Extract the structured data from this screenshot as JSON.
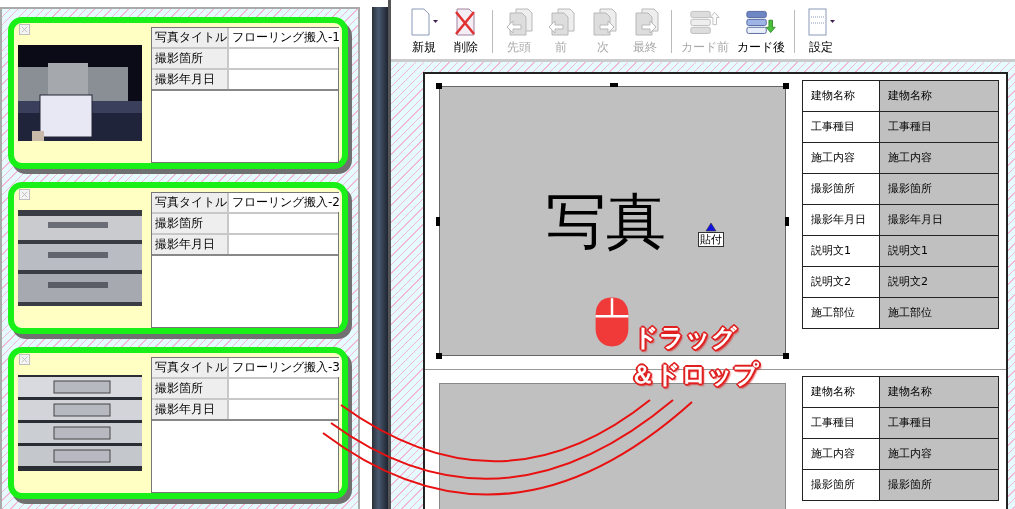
{
  "photo_list": {
    "cards": [
      {
        "kind": "picture",
        "selected": true,
        "title_label": "写真タイトル",
        "title": "フローリング搬入-1",
        "fields": [
          {
            "label": "撮影箇所"
          },
          {
            "label": "撮影年月日"
          }
        ]
      },
      {
        "kind": "picture",
        "selected": true,
        "title_label": "写真タイトル",
        "title": "フローリング搬入-2",
        "fields": [
          {
            "label": "撮影箇所"
          },
          {
            "label": "撮影年月日"
          }
        ]
      },
      {
        "kind": "picture",
        "selected": true,
        "title_label": "写真タイトル",
        "title": "フローリング搬入-3",
        "fields": [
          {
            "label": "撮影箇所"
          },
          {
            "label": "撮影年月日"
          }
        ]
      }
    ]
  },
  "toolbar": {
    "groups": [
      [
        {
          "kind": "new",
          "label": "新規",
          "disabled": false
        },
        {
          "kind": "delete",
          "label": "削除",
          "disabled": false
        }
      ],
      [
        {
          "kind": "first",
          "label": "先頭",
          "disabled": true
        },
        {
          "kind": "prev",
          "label": "前",
          "disabled": true
        },
        {
          "kind": "next",
          "label": "次",
          "disabled": true
        },
        {
          "kind": "last",
          "label": "最終",
          "disabled": true
        }
      ],
      [
        {
          "kind": "card_before",
          "label": "カード前",
          "disabled": true
        },
        {
          "kind": "card_after",
          "label": "カード後",
          "disabled": false
        }
      ],
      [
        {
          "kind": "settings",
          "label": "設定",
          "disabled": false
        }
      ]
    ]
  },
  "editor": {
    "cards": [
      {
        "photo_label": "写真",
        "paste_label": "貼付",
        "selected": true,
        "fields": [
          {
            "label": "建物名称",
            "value": "建物名称"
          },
          {
            "label": "工事種目",
            "value": "工事種目"
          },
          {
            "label": "施工内容",
            "value": "施工内容"
          },
          {
            "label": "撮影箇所",
            "value": "撮影箇所"
          },
          {
            "label": "撮影年月日",
            "value": "撮影年月日"
          },
          {
            "label": "説明文1",
            "value": "説明文1"
          },
          {
            "label": "説明文2",
            "value": "説明文2"
          },
          {
            "label": "施工部位",
            "value": "施工部位"
          }
        ]
      },
      {
        "selected": false,
        "fields": [
          {
            "label": "建物名称",
            "value": "建物名称"
          },
          {
            "label": "工事種目",
            "value": "工事種目"
          },
          {
            "label": "施工内容",
            "value": "施工内容"
          },
          {
            "label": "撮影箇所",
            "value": "撮影箇所"
          }
        ]
      }
    ]
  },
  "drag_hint": {
    "lines": [
      "ドラッグ",
      "＆ドロップ"
    ]
  }
}
